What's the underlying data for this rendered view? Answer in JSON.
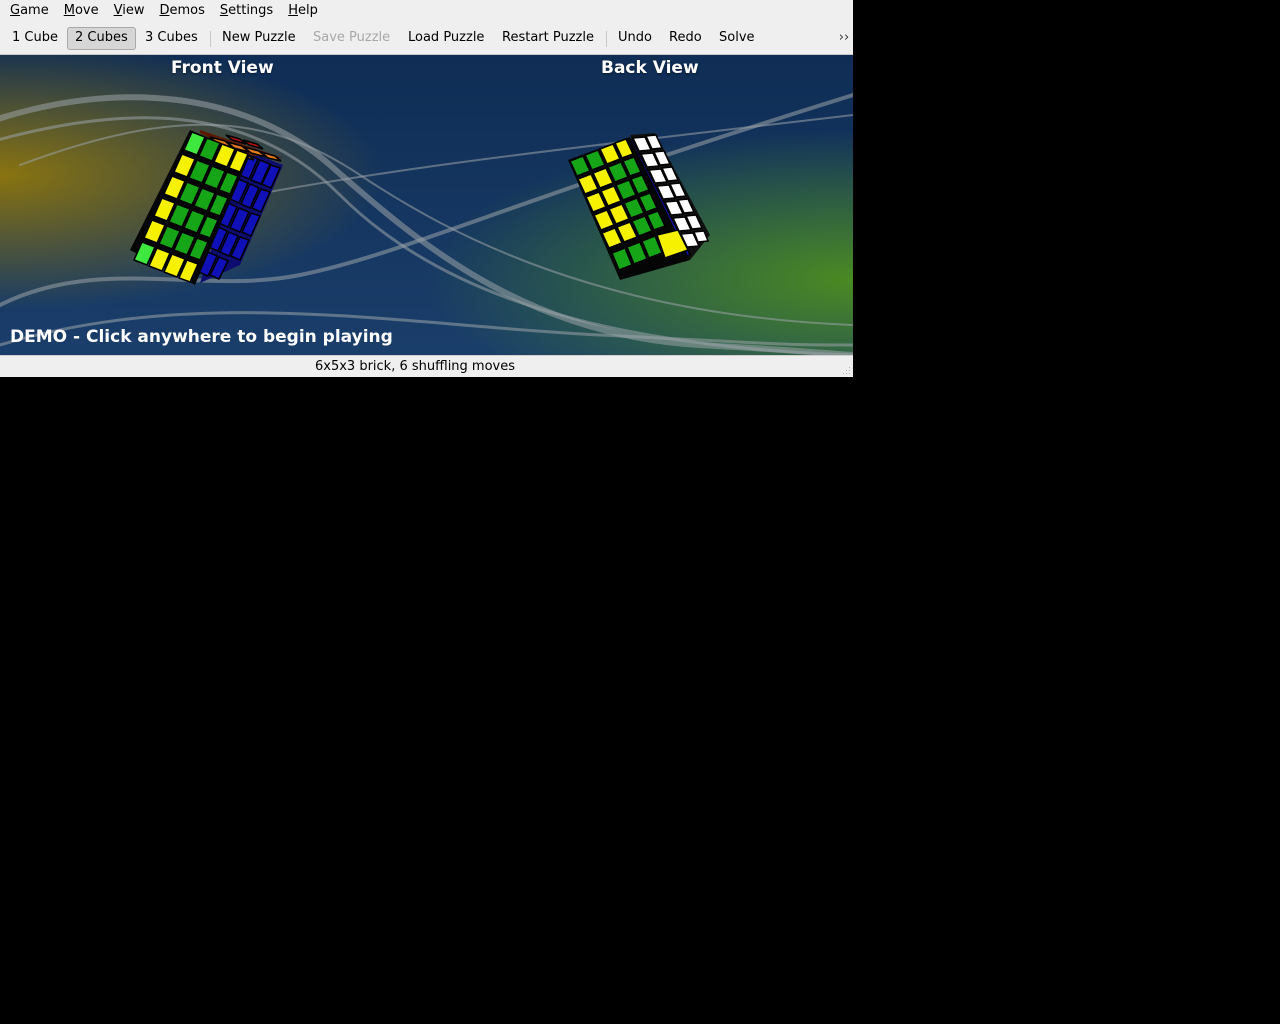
{
  "menu": [
    {
      "mnemonic": "G",
      "rest": "ame"
    },
    {
      "mnemonic": "M",
      "rest": "ove"
    },
    {
      "mnemonic": "V",
      "rest": "iew"
    },
    {
      "mnemonic": "D",
      "rest": "emos"
    },
    {
      "mnemonic": "S",
      "rest": "ettings"
    },
    {
      "mnemonic": "H",
      "rest": "elp"
    }
  ],
  "toolbar": {
    "one_cube": "1 Cube",
    "two_cubes": "2 Cubes",
    "three_cubes": "3 Cubes",
    "new_puzzle": "New Puzzle",
    "save_puzzle": "Save Puzzle",
    "load_puzzle": "Load Puzzle",
    "restart_puzzle": "Restart Puzzle",
    "undo": "Undo",
    "redo": "Redo",
    "solve": "Solve",
    "more": "››",
    "active_button": "2 Cubes",
    "disabled_button": "Save Puzzle"
  },
  "scene": {
    "front_title": "Front View",
    "back_title": "Back View",
    "demo_message": "DEMO - Click anywhere to begin playing",
    "colors": {
      "background_center": "#17345f",
      "background_left": "#7d6a12",
      "background_right": "#3f7a22",
      "yellow": "#f5f100",
      "green": "#16a516",
      "bright_green": "#3ee83e",
      "blue": "#1010b8",
      "orange": "#e07a1a",
      "red": "#b01010",
      "white": "#ffffff"
    }
  },
  "status": {
    "text": "6x5x3 brick, 6 shuffling moves"
  }
}
